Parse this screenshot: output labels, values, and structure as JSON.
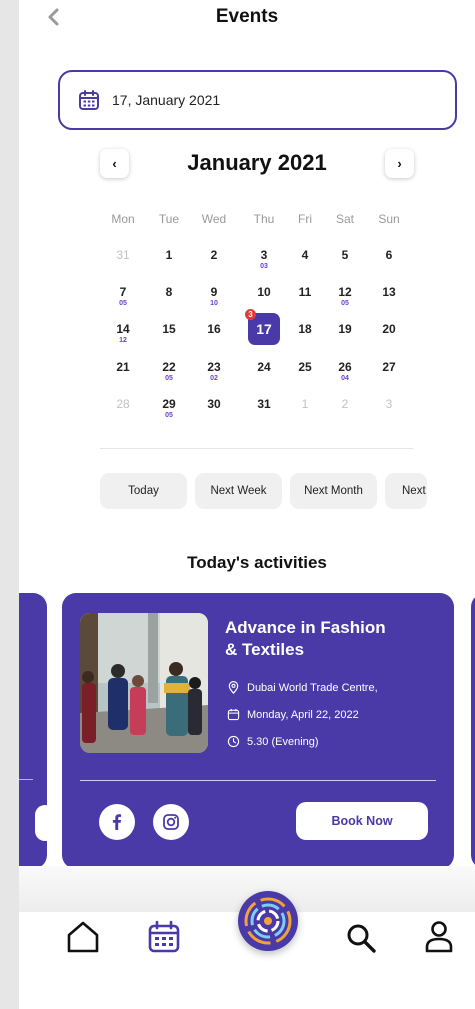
{
  "header": {
    "title": "Events"
  },
  "date_field": {
    "value": "17, January 2021"
  },
  "calendar": {
    "month_label": "January 2021",
    "prev_label": "‹",
    "next_label": "›",
    "weekdays": [
      "Mon",
      "Tue",
      "Wed",
      "Thu",
      "Fri",
      "Sat",
      "Sun"
    ],
    "rows": [
      [
        {
          "n": "31",
          "m": true
        },
        {
          "n": "1"
        },
        {
          "n": "2"
        },
        {
          "n": "3",
          "s": "03"
        },
        {
          "n": "4"
        },
        {
          "n": "5"
        },
        {
          "n": "6"
        }
      ],
      [
        {
          "n": "7",
          "s": "05"
        },
        {
          "n": "8"
        },
        {
          "n": "9",
          "s": "10"
        },
        {
          "n": "10"
        },
        {
          "n": "11"
        },
        {
          "n": "12",
          "s": "05"
        },
        {
          "n": "13"
        }
      ],
      [
        {
          "n": "14",
          "s": "12"
        },
        {
          "n": "15"
        },
        {
          "n": "16"
        },
        {
          "n": "17",
          "sel": true,
          "badge": "3"
        },
        {
          "n": "18"
        },
        {
          "n": "19"
        },
        {
          "n": "20"
        }
      ],
      [
        {
          "n": "21"
        },
        {
          "n": "22",
          "s": "05"
        },
        {
          "n": "23",
          "s": "02"
        },
        {
          "n": "24"
        },
        {
          "n": "25"
        },
        {
          "n": "26",
          "s": "04"
        },
        {
          "n": "27"
        }
      ],
      [
        {
          "n": "28",
          "m": true
        },
        {
          "n": "29",
          "s": "05"
        },
        {
          "n": "30"
        },
        {
          "n": "31"
        },
        {
          "n": "1",
          "m": true
        },
        {
          "n": "2",
          "m": true
        },
        {
          "n": "3",
          "m": true
        }
      ]
    ]
  },
  "quick_filters": [
    "Today",
    "Next Week",
    "Next Month",
    "Next"
  ],
  "activities": {
    "title": "Today's activities",
    "event": {
      "title_line1": "Advance in Fashion",
      "title_line2": "& Textiles",
      "location": "Dubai World Trade Centre,",
      "date": "Monday, April 22, 2022",
      "time": "5.30 (Evening)",
      "book_label": "Book Now"
    }
  },
  "colors": {
    "primary": "#4a3aa7",
    "badge": "#e53935",
    "event_marker": "#6b3fd4"
  },
  "bottom_nav": [
    "home-icon",
    "calendar-icon",
    "logo-icon",
    "search-icon",
    "profile-icon"
  ]
}
